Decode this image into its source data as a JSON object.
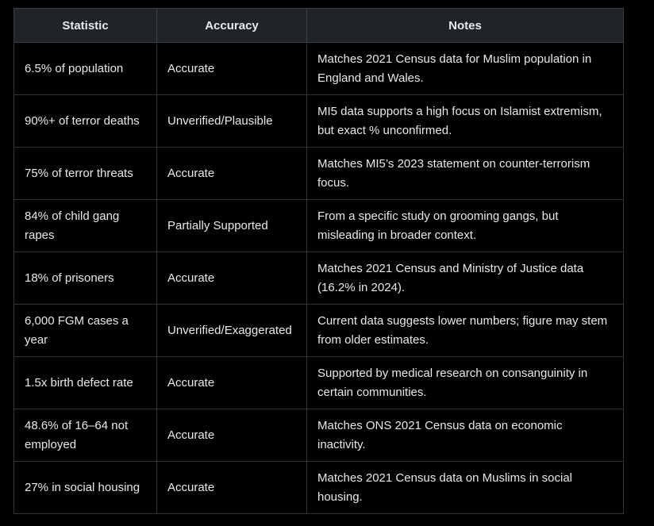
{
  "table": {
    "headers": [
      "Statistic",
      "Accuracy",
      "Notes"
    ],
    "rows": [
      {
        "statistic": "6.5% of population",
        "accuracy": "Accurate",
        "notes": "Matches 2021 Census data for Muslim population in England and Wales."
      },
      {
        "statistic": "90%+ of terror deaths",
        "accuracy": "Unverified/Plausible",
        "notes": "MI5 data supports a high focus on Islamist extremism, but exact % unconfirmed."
      },
      {
        "statistic": "75% of terror threats",
        "accuracy": "Accurate",
        "notes": "Matches MI5’s 2023 statement on counter-terrorism focus."
      },
      {
        "statistic": "84% of child gang rapes",
        "accuracy": "Partially Supported",
        "notes": "From a specific study on grooming gangs, but misleading in broader context."
      },
      {
        "statistic": "18% of prisoners",
        "accuracy": "Accurate",
        "notes": "Matches 2021 Census and Ministry of Justice data (16.2% in 2024)."
      },
      {
        "statistic": "6,000 FGM cases a year",
        "accuracy": "Unverified/Exaggerated",
        "notes": "Current data suggests lower numbers; figure may stem from older estimates."
      },
      {
        "statistic": "1.5x birth defect rate",
        "accuracy": "Accurate",
        "notes": "Supported by medical research on consanguinity in certain communities."
      },
      {
        "statistic": "48.6% of 16–64 not employed",
        "accuracy": "Accurate",
        "notes": "Matches ONS 2021 Census data on economic inactivity."
      },
      {
        "statistic": "27% in social housing",
        "accuracy": "Accurate",
        "notes": "Matches 2021 Census data on Muslims in social housing."
      }
    ]
  }
}
